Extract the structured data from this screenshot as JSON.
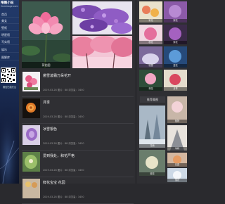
{
  "sidebar": {
    "logo_title": "唯图小站",
    "logo_sub": "2smimage.com",
    "nav": [
      "首页",
      "美女",
      "壁纸",
      "明星馆",
      "写实馆",
      "娱乐",
      "图解库"
    ],
    "qr_caption": "微信扫描关注"
  },
  "main": {
    "hero_caption": "荷花图",
    "items": [
      {
        "title": "傲雪凌霜万朵花开",
        "meta": "2019-03-28  图片：88  浏览量：3450"
      },
      {
        "title": "月季",
        "meta": "2019-03-28  图片：88  浏览量：3450"
      },
      {
        "title": "冰雪银色",
        "meta": "2019-03-28  图片：88  浏览量：3450"
      },
      {
        "title": "爱到我处，和花严格",
        "meta": "2019-03-28  图片：88  浏览量：3450"
      },
      {
        "title": "鲜花宝宝 花园",
        "meta": "2019-03-28  图片：88  浏览量：3450"
      }
    ]
  },
  "right": {
    "section_head": "推荐美图",
    "labels": [
      "彩花",
      "紫花",
      "粉花",
      "紫花",
      "仙雪",
      "蓝花",
      "荷花",
      "月季",
      "植物",
      "花雨",
      "冰树",
      "菊花",
      "花园",
      "雪花"
    ]
  }
}
